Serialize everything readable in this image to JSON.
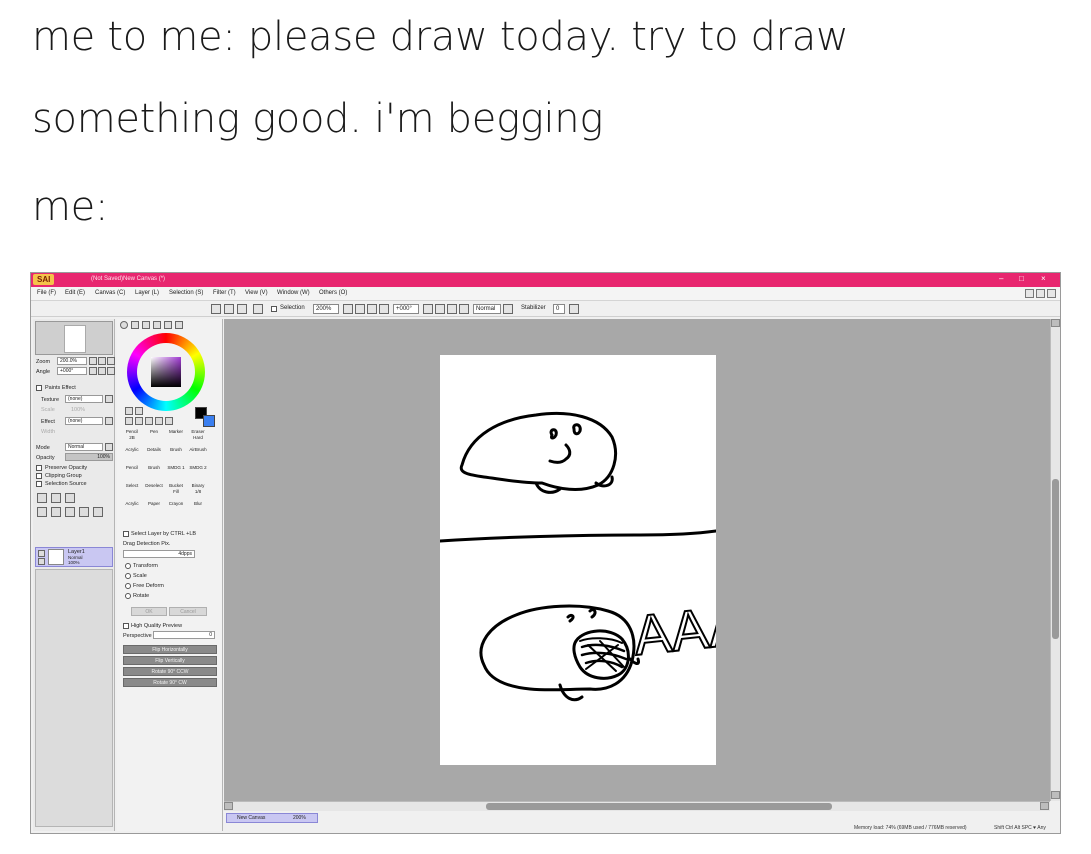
{
  "caption": {
    "line1": "me to me: please draw today. try to draw",
    "line2": "something good. i'm begging",
    "line3": "me:"
  },
  "window": {
    "logo": "SAI",
    "title": "(Not Saved)New Canvas (*)",
    "controls": [
      "–",
      "□",
      "×"
    ]
  },
  "menu": [
    "File (F)",
    "Edit (E)",
    "Canvas (C)",
    "Layer (L)",
    "Selection (S)",
    "Filter (T)",
    "View (V)",
    "Window (W)",
    "Others (O)"
  ],
  "toolbar": {
    "selection_label": "Selection",
    "zoom": "200%",
    "angle": "+000°",
    "mode": "Normal",
    "stabilizer_label": "Stabilizer",
    "stabilizer_value": "0"
  },
  "navigator": {
    "zoom_label": "Zoom",
    "zoom_value": "200.0%",
    "angle_label": "Angle",
    "angle_value": "+000°",
    "paints_effect": "Paints Effect",
    "texture_label": "Texture",
    "texture_value": "(none)",
    "scale_label": "Scale",
    "scale_value": "100%",
    "effect_label": "Effect",
    "effect_value": "(none)",
    "width_label": "Width",
    "mode_label": "Mode",
    "mode_value": "Normal",
    "opacity_label": "Opacity",
    "opacity_value": "100%",
    "checks": [
      "Preserve Opacity",
      "Clipping Group",
      "Selection Source"
    ],
    "layer_name": "Layer1",
    "layer_mode": "Normal",
    "layer_opacity": "100%"
  },
  "tools": {
    "row1": [
      "Pencil",
      "Pen",
      "Marker",
      "Eraser"
    ],
    "row1_sub": [
      "2B",
      "",
      "",
      "Hard"
    ],
    "row2": [
      "Acrylic",
      "Details",
      "Brush",
      "AirBrush"
    ],
    "row3": [
      "Pencil",
      "Brush",
      "SMDG 1",
      "SMDG 2"
    ],
    "row4": [
      "Select",
      "Deselect",
      "Bucket",
      "Binary"
    ],
    "row4_sub": [
      "",
      "",
      "Fill",
      "1/8"
    ],
    "row5": [
      "Acrylic",
      "Paper",
      "Crayon",
      "Blur"
    ],
    "select_layer_label": "Select Layer by CTRL +LB",
    "drag_detection": "Drag Detection Pix.",
    "drag_value": "4dpps",
    "transform_options": [
      "Transform",
      "Scale",
      "Free Deform",
      "Rotate"
    ],
    "ok": "OK",
    "cancel": "Cancel",
    "hq_preview": "High Quality Preview",
    "perspective_label": "Perspective",
    "perspective_value": "0",
    "actions": [
      "Flip Horizontally",
      "Flip Vertically",
      "Rotate 90° CCW",
      "Rotate 90° CW"
    ]
  },
  "canvas": {
    "scream_text": "AAA"
  },
  "doc_tab": {
    "name": "New Canvas",
    "zoom": "200%"
  },
  "status": {
    "memory": "Memory load: 74% (69MB used / 776MB reserved)",
    "keys": "Shift Ctrl Alt SPC ♥ Any"
  },
  "colors": {
    "titlebar": "#e8266f",
    "canvas_bg": "#a8a8a8",
    "layer_selected": "#c9c7f2"
  }
}
